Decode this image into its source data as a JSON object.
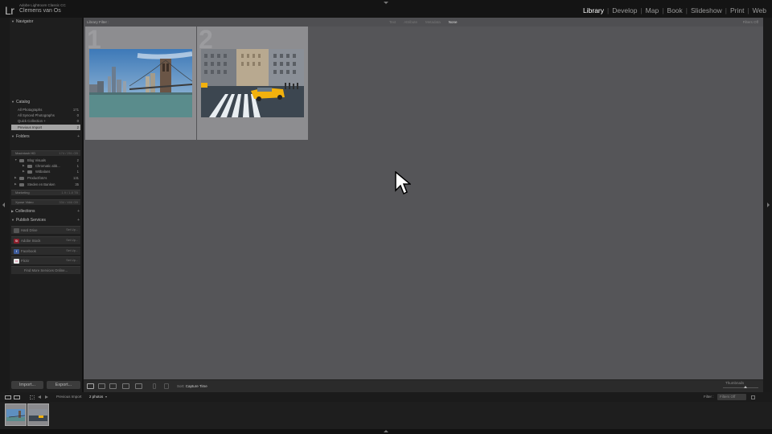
{
  "window": {
    "app_name": "Adobe Lightroom Classic CC",
    "user_name": "Clemens van Os",
    "logo": "Lr"
  },
  "modules": [
    {
      "label": "Library",
      "active": true
    },
    {
      "label": "Develop",
      "active": false
    },
    {
      "label": "Map",
      "active": false
    },
    {
      "label": "Book",
      "active": false
    },
    {
      "label": "Slideshow",
      "active": false
    },
    {
      "label": "Print",
      "active": false
    },
    {
      "label": "Web",
      "active": false
    }
  ],
  "left_panel": {
    "navigator": {
      "title": "Navigator"
    },
    "catalog": {
      "title": "Catalog",
      "items": [
        {
          "label": "All Photographs",
          "count": "171"
        },
        {
          "label": "All Synced Photographs",
          "count": "0"
        },
        {
          "label": "Quick Collection +",
          "count": "0"
        },
        {
          "label": "Previous Import",
          "count": "2"
        }
      ]
    },
    "folders": {
      "title": "Folders",
      "volumes": [
        {
          "label": "Macintosh HD",
          "stat": "174 / 251 GB"
        },
        {
          "label": "Marketing",
          "stat": "1.9 / 1.8 TB"
        },
        {
          "label": "Xpose Video",
          "stat": "334 / 466 GB"
        }
      ],
      "items": [
        {
          "label": "Blog Visuals",
          "count": "2"
        },
        {
          "label": "Chromatic abb...",
          "count": "1"
        },
        {
          "label": "Witbalans",
          "count": "1"
        },
        {
          "label": "Productfoto's",
          "count": "131"
        },
        {
          "label": "Steden en Banken",
          "count": "35"
        }
      ]
    },
    "collections": {
      "title": "Collections"
    },
    "publish_services": {
      "title": "Publish Services",
      "items": [
        {
          "label": "Hard Drive",
          "badge": "",
          "setup": "Set Up..."
        },
        {
          "label": "Adobe Stock",
          "badge": "St",
          "setup": "Set Up..."
        },
        {
          "label": "Facebook",
          "badge": "f",
          "setup": "Set Up..."
        },
        {
          "label": "Flickr",
          "badge": "••",
          "setup": "Set Up..."
        }
      ],
      "find_more": "Find More Services Online..."
    },
    "import_label": "Import...",
    "export_label": "Export..."
  },
  "grid": {
    "filter_title": "Library Filter :",
    "filter_options": [
      {
        "label": "Text",
        "on": false
      },
      {
        "label": "Attribute",
        "on": false
      },
      {
        "label": "Metadata",
        "on": false
      },
      {
        "label": "None",
        "on": true
      }
    ],
    "filter_status": "Filters Off",
    "cells": [
      {
        "number": "1",
        "description": "brooklyn-bridge-photo"
      },
      {
        "number": "2",
        "description": "nyc-street-taxi-photo"
      }
    ]
  },
  "toolbar": {
    "sort_label": "Sort:",
    "sort_value": "Capture Time",
    "thumbnails_label": "Thumbnails"
  },
  "filmstrip_bar": {
    "source_label": "Previous Import",
    "count_label": "2 photos",
    "filter_label": "Filter :",
    "filter_value": "Filters Off"
  },
  "colors": {
    "grid_bg": "#555558",
    "cell_bg": "#8d8d90",
    "panel_bg": "#1e1e1e",
    "selected_row": "#a5a5a5",
    "taxi_yellow": "#f2b10d"
  }
}
